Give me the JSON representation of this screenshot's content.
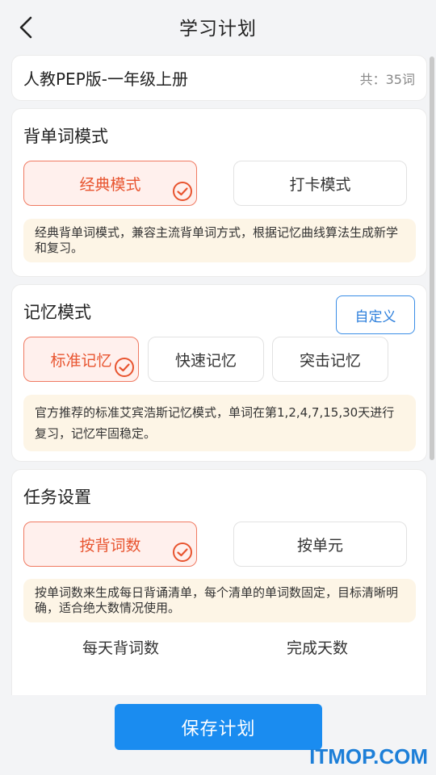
{
  "header": {
    "title": "学习计划",
    "back_icon": "chevron-left-icon"
  },
  "book": {
    "title": "人教PEP版-一年级上册",
    "count": "共：35词"
  },
  "word_mode": {
    "title": "背单词模式",
    "options": [
      {
        "label": "经典模式",
        "selected": true
      },
      {
        "label": "打卡模式",
        "selected": false
      }
    ],
    "description": "经典背单词模式，兼容主流背单词方式，根据记忆曲线算法生成新学和复习。"
  },
  "memory_mode": {
    "title": "记忆模式",
    "custom_label": "自定义",
    "options": [
      {
        "label": "标准记忆",
        "selected": true
      },
      {
        "label": "快速记忆",
        "selected": false
      },
      {
        "label": "突击记忆",
        "selected": false
      }
    ],
    "description": "官方推荐的标准艾宾浩斯记忆模式，单词在第1,2,4,7,15,30天进行复习，记忆牢固稳定。"
  },
  "task": {
    "title": "任务设置",
    "options": [
      {
        "label": "按背词数",
        "selected": true
      },
      {
        "label": "按单元",
        "selected": false
      }
    ],
    "description": "按单词数来生成每日背诵清单，每个清单的单词数固定，目标清晰明确，适合绝大数情况使用。",
    "columns": [
      "每天背词数",
      "完成天数"
    ]
  },
  "save_label": "保存计划",
  "watermark": "ITMOP.COM",
  "colors": {
    "accent": "#e8542f",
    "primary": "#1a8cf0",
    "tip_bg": "#fdf5e6"
  }
}
